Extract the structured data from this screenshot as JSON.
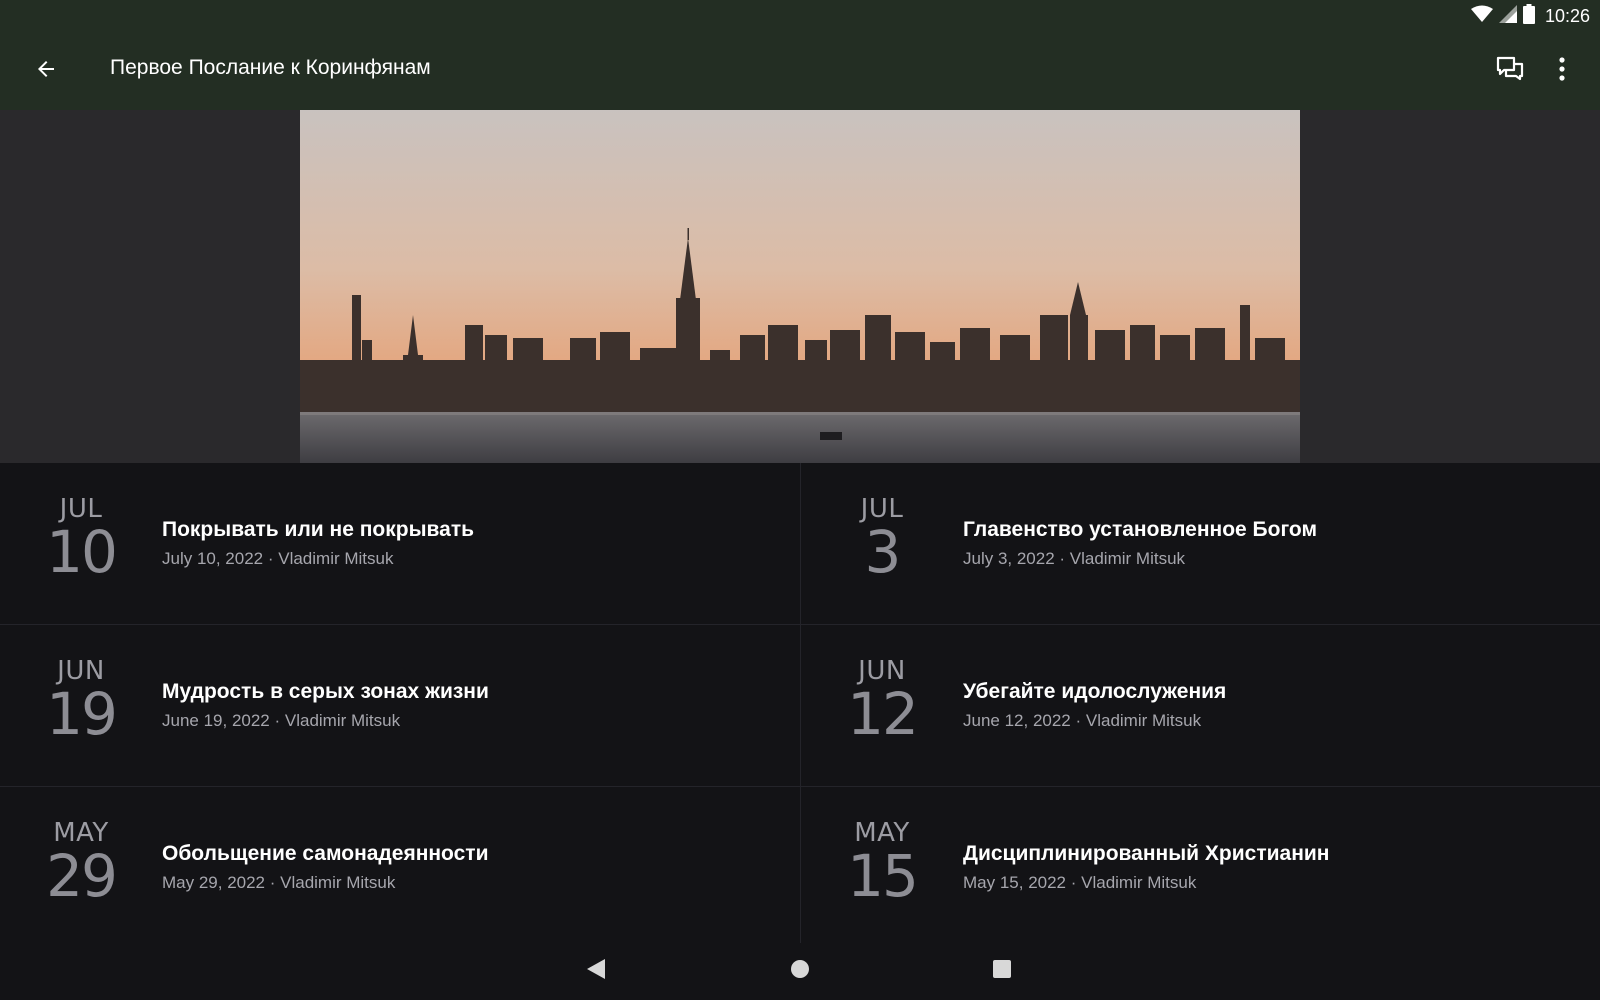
{
  "status_bar": {
    "time": "10:26",
    "icons": [
      "wifi-icon",
      "cell-signal-icon",
      "battery-icon"
    ]
  },
  "app_bar": {
    "title": "Первое Послание к Коринфянам",
    "back_icon": "arrow-back-icon",
    "actions": [
      "chat-icon",
      "more-vert-icon"
    ]
  },
  "hero": {
    "image": "city-skyline-at-sunset"
  },
  "sermons": [
    {
      "month": "JUL",
      "day": "10",
      "title": "Покрывать или не покрывать",
      "meta": "July 10, 2022 · Vladimir Mitsuk"
    },
    {
      "month": "JUL",
      "day": "3",
      "title": "Главенство установленное Богом",
      "meta": "July 3, 2022 · Vladimir Mitsuk"
    },
    {
      "month": "JUN",
      "day": "19",
      "title": "Мудрость в серых зонах жизни",
      "meta": "June 19, 2022 · Vladimir Mitsuk"
    },
    {
      "month": "JUN",
      "day": "12",
      "title": "Убегайте идолослужения",
      "meta": "June 12, 2022 · Vladimir Mitsuk"
    },
    {
      "month": "MAY",
      "day": "29",
      "title": "Обольщение самонадеянности",
      "meta": "May 29, 2022 · Vladimir Mitsuk"
    },
    {
      "month": "MAY",
      "day": "15",
      "title": "Дисциплинированный Христианин",
      "meta": "May 15, 2022 · Vladimir Mitsuk"
    }
  ],
  "nav_bar": {
    "buttons": [
      "nav-back-icon",
      "nav-home-icon",
      "nav-recents-icon"
    ]
  },
  "colors": {
    "app_bar": "#232e23",
    "background": "#131316",
    "hero_background": "#2a292c",
    "title_text": "#ffffff",
    "meta_text": "#a6a6ad",
    "date_text": "#8d8d94"
  }
}
